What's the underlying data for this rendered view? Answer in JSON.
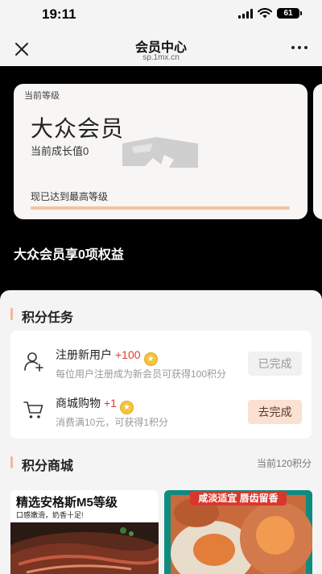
{
  "status_bar": {
    "time": "19:11",
    "battery": "61"
  },
  "nav": {
    "title": "会员中心",
    "subtitle": "sp.1mx.cn"
  },
  "level_card": {
    "tag": "当前等级",
    "level_name": "大众会员",
    "growth": "当前成长值0",
    "max_level_text": "现已达到最高等级",
    "progress": 1.0
  },
  "benefits_text": "大众会员享0项权益",
  "tasks": {
    "title": "积分任务",
    "items": [
      {
        "title": "注册新用户",
        "points": "+100",
        "desc": "每位用户注册成为新会员可获得100积分",
        "button": "已完成",
        "status": "done"
      },
      {
        "title": "商城购物",
        "points": "+1",
        "desc": "消费满10元，可获得1积分",
        "button": "去完成",
        "status": "todo"
      }
    ]
  },
  "mall": {
    "title": "积分商城",
    "balance": "当前120积分",
    "products": [
      {
        "title": "精选安格斯M5等级",
        "subtitle": "口感嫩滑，奶香十足!"
      },
      {
        "banner": "咸淡适宜 唇齿留香"
      }
    ]
  },
  "colors": {
    "accent": "#f0b79a",
    "points_red": "#e23b2a",
    "button_go_bg": "#fbe1d2"
  }
}
